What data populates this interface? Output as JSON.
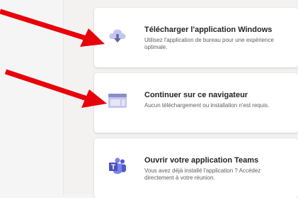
{
  "options": [
    {
      "id": "download-windows",
      "title": "Télécharger l'application Windows",
      "description": "Utilisez l'application de bureau pour une expérience optimale.",
      "icon": "cloud-download-icon"
    },
    {
      "id": "continue-browser",
      "title": "Continuer sur ce navigateur",
      "description": "Aucun téléchargement ou installation n'est requis.",
      "icon": "browser-window-icon"
    },
    {
      "id": "open-teams",
      "title": "Ouvrir votre application Teams",
      "description": "Vous avez déjà installé l'application ? Accédez directement à votre réunion.",
      "icon": "teams-logo-icon"
    }
  ],
  "colors": {
    "accent": "#6264a7",
    "arrow": "#e8000b",
    "card_bg": "#ffffff",
    "page_bg": "#f3f2f1"
  }
}
